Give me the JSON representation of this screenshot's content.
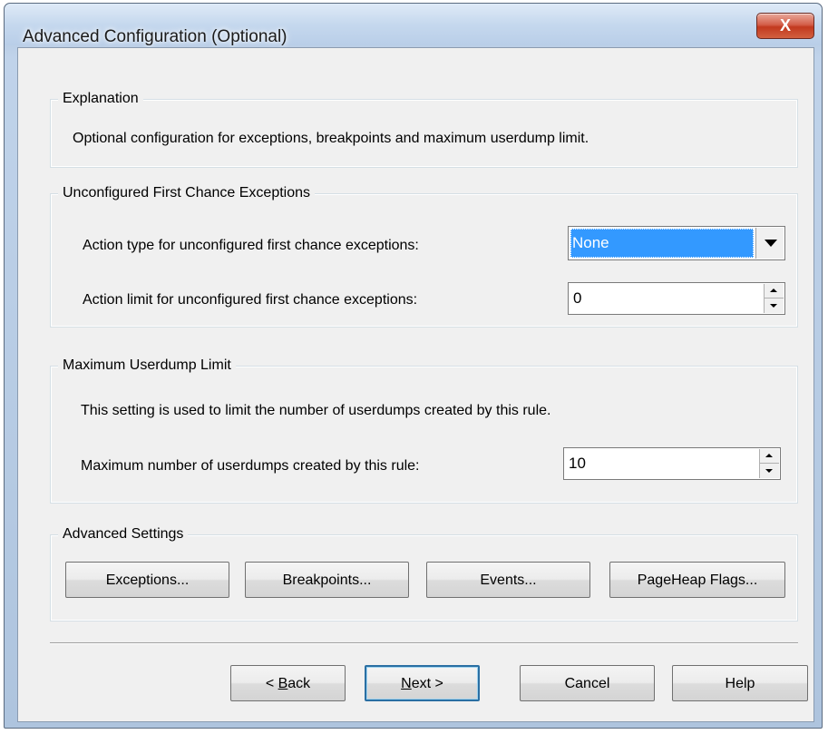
{
  "window": {
    "title": "Advanced Configuration (Optional)",
    "close_glyph": "X"
  },
  "explanation": {
    "legend": "Explanation",
    "text": "Optional configuration for exceptions, breakpoints and maximum userdump limit."
  },
  "first_chance": {
    "legend": "Unconfigured First Chance Exceptions",
    "action_type_label": "Action type for unconfigured first chance exceptions:",
    "action_type_value": "None",
    "action_limit_label": "Action limit for unconfigured first chance exceptions:",
    "action_limit_value": "0"
  },
  "userdump": {
    "legend": "Maximum Userdump Limit",
    "description": "This setting is used to limit the number of userdumps created by this rule.",
    "max_label": "Maximum number of userdumps created by this rule:",
    "max_value": "10"
  },
  "advanced": {
    "legend": "Advanced Settings",
    "buttons": [
      "Exceptions...",
      "Breakpoints...",
      "Events...",
      "PageHeap Flags..."
    ]
  },
  "footer": {
    "back": {
      "accel": "B",
      "before": "< ",
      "after": "ack"
    },
    "next": {
      "accel": "N",
      "after": "ext >"
    },
    "cancel": "Cancel",
    "help": "Help"
  },
  "colors": {
    "selection": "#3399ff",
    "dialog_bg": "#f0f0f0",
    "close_red": "#c2391f",
    "default_button_border": "#2a6fa3"
  },
  "icons": {
    "close": "close-icon",
    "combo_dropdown": "chevron-down-icon",
    "spin_up": "arrow-up-icon",
    "spin_down": "arrow-down-icon"
  }
}
